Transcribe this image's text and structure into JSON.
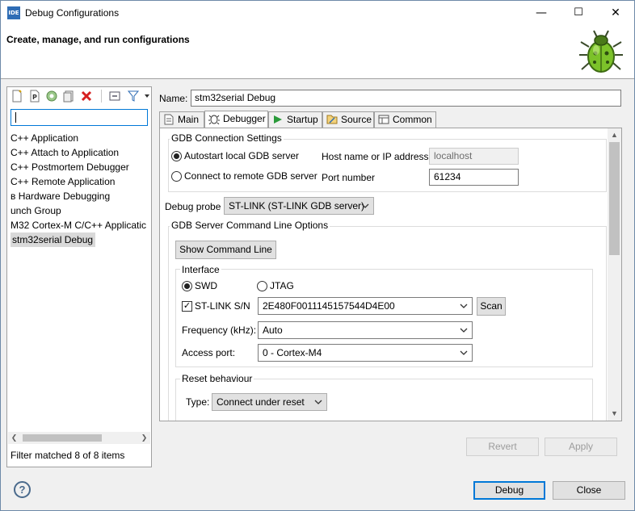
{
  "window": {
    "title": "Debug Configurations",
    "app_icon": "IDE",
    "minimize": "—",
    "maximize": "☐",
    "close": "✕"
  },
  "banner": {
    "title": "Create, manage, and run configurations"
  },
  "toolbar": {
    "icons": [
      "new-config-icon",
      "new-prototype-icon",
      "duplicate-icon",
      "export-icon",
      "delete-icon",
      "collapse-all-icon",
      "filter-icon",
      "view-menu-icon"
    ]
  },
  "filter": {
    "value": ""
  },
  "tree": {
    "items": [
      {
        "label": "C++ Application"
      },
      {
        "label": "C++ Attach to Application"
      },
      {
        "label": "C++ Postmortem Debugger"
      },
      {
        "label": "C++ Remote Application"
      },
      {
        "label": "ʙ Hardware Debugging"
      },
      {
        "label": "unch Group"
      },
      {
        "label": "M32 Cortex-M C/C++ Applicatic"
      },
      {
        "label": "stm32serial Debug"
      }
    ]
  },
  "filter_status": "Filter matched 8 of 8 items",
  "name": {
    "label": "Name:",
    "value": "stm32serial Debug"
  },
  "tabs": [
    "Main",
    "Debugger",
    "Startup",
    "Source",
    "Common"
  ],
  "gdb": {
    "group_title": "GDB Connection Settings",
    "autostart": "Autostart local GDB server",
    "connect_remote": "Connect to remote GDB server",
    "host_label": "Host name or IP address",
    "host_value": "localhost",
    "port_label": "Port number",
    "port_value": "61234"
  },
  "probe": {
    "label": "Debug probe",
    "value": "ST-LINK (ST-LINK GDB server)"
  },
  "server": {
    "group_title": "GDB Server Command Line Options",
    "show_cmd": "Show Command Line",
    "interface_title": "Interface",
    "swd": "SWD",
    "jtag": "JTAG",
    "stlink_sn_label": "ST-LINK S/N",
    "stlink_sn_value": "2E480F0011145157544D4E00",
    "scan": "Scan",
    "freq_label": "Frequency (kHz):",
    "freq_value": "Auto",
    "access_label": "Access port:",
    "access_value": "0 - Cortex-M4",
    "reset_title": "Reset behaviour",
    "type_label": "Type:",
    "type_value": "Connect under reset"
  },
  "actions": {
    "revert": "Revert",
    "apply": "Apply",
    "debug": "Debug",
    "close": "Close"
  },
  "help": "?"
}
